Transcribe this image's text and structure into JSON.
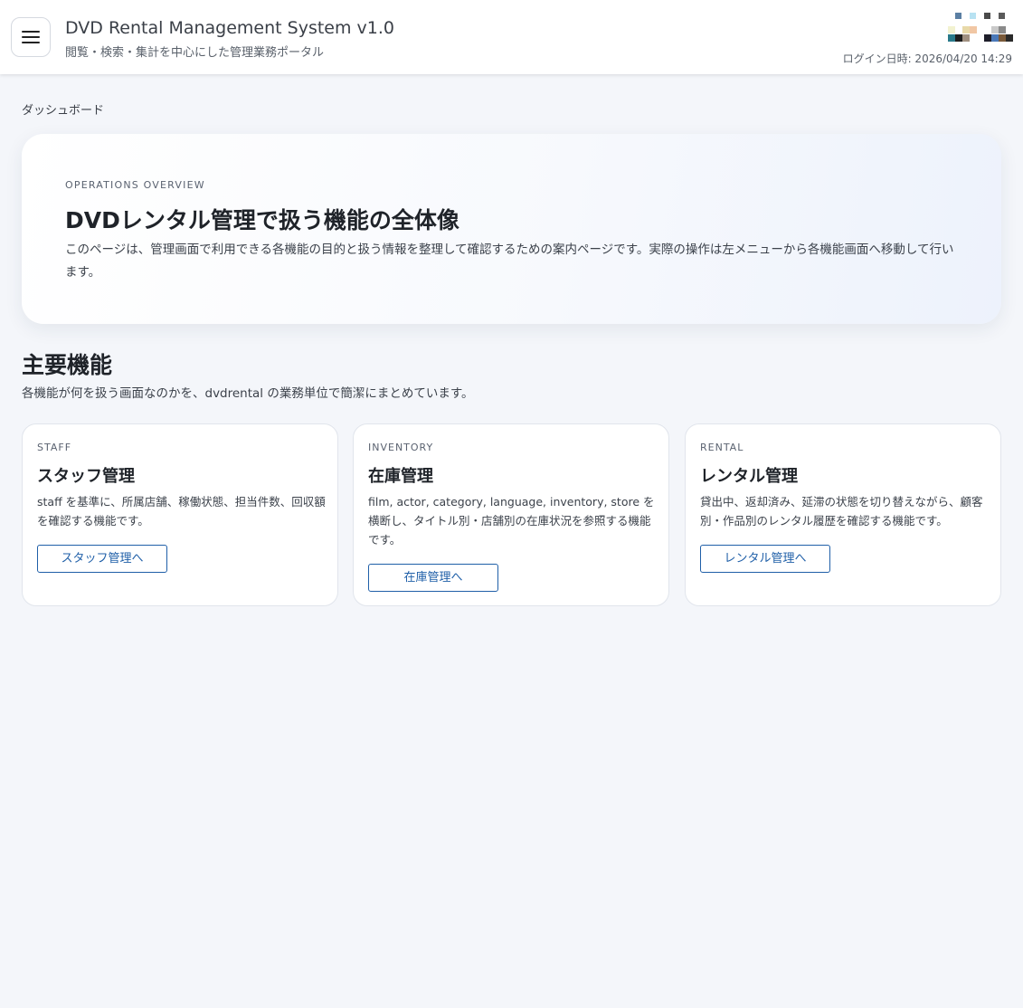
{
  "header": {
    "title": "DVD Rental Management System v1.0",
    "subtitle": "閲覧・検索・集計を中心にした管理業務ポータル",
    "login_time": "ログイン日時: 2026/04/20 14:29",
    "menu_icon": "hamburger-menu-icon",
    "avatar_icon": "user-avatar-icon"
  },
  "breadcrumb": "ダッシュボード",
  "hero": {
    "eyebrow": "OPERATIONS OVERVIEW",
    "title": "DVDレンタル管理で扱う機能の全体像",
    "description": "このページは、管理画面で利用できる各機能の目的と扱う情報を整理して確認するための案内ページです。実際の操作は左メニューから各機能画面へ移動して行います。"
  },
  "section": {
    "title": "主要機能",
    "description": "各機能が何を扱う画面なのかを、dvdrental の業務単位で簡潔にまとめています。"
  },
  "cards": [
    {
      "eyebrow": "STAFF",
      "title": "スタッフ管理",
      "description": "staff を基準に、所属店舗、稼働状態、担当件数、回収額を確認する機能です。",
      "button": "スタッフ管理へ"
    },
    {
      "eyebrow": "INVENTORY",
      "title": "在庫管理",
      "description": "film, actor, category, language, inventory, store を横断し、タイトル別・店舗別の在庫状況を参照する機能です。",
      "button": "在庫管理へ"
    },
    {
      "eyebrow": "RENTAL",
      "title": "レンタル管理",
      "description": "貸出中、返却済み、延滞の状態を切り替えながら、顧客別・作品別のレンタル履歴を確認する機能です。",
      "button": "レンタル管理へ"
    }
  ],
  "colors": {
    "accent": "#1f5fa8",
    "background": "#f4f6fa",
    "card": "#ffffff"
  }
}
